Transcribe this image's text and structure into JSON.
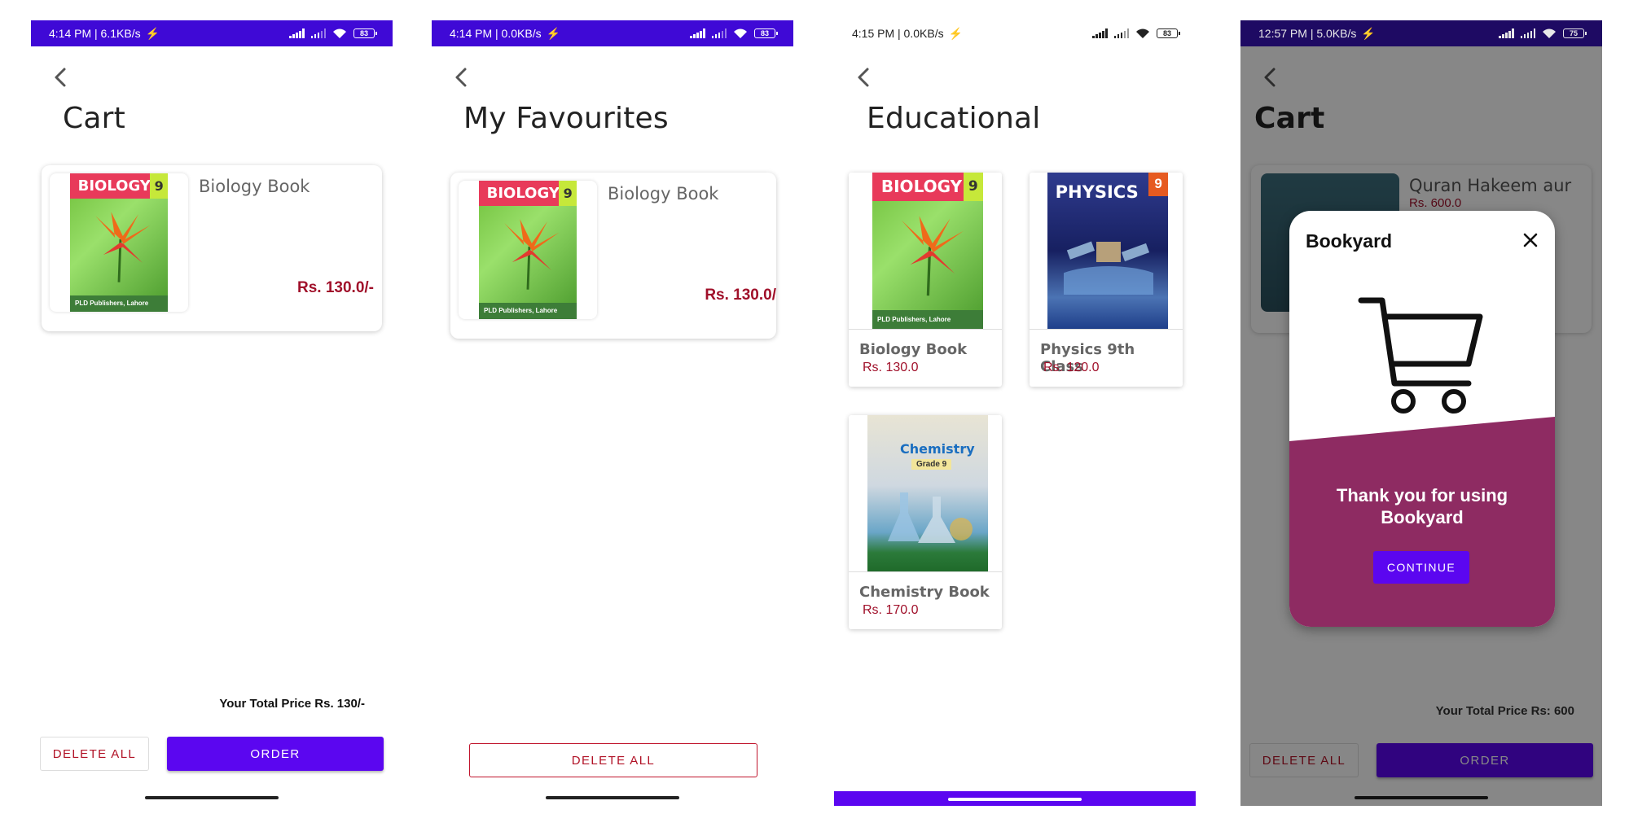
{
  "screens": {
    "cart": {
      "status": {
        "time": "4:14 PM | 6.1KB/s",
        "battery": "83"
      },
      "title": "Cart",
      "item": {
        "name": "Biology Book",
        "price": "Rs. 130.0/-",
        "cover_title": "BIOLOGY",
        "cover_grade": "9",
        "cover_publisher": "PLD Publishers, Lahore"
      },
      "total": "Your Total Price Rs. 130/-",
      "delete_all": "DELETE ALL",
      "order": "ORDER"
    },
    "favourites": {
      "status": {
        "time": "4:14 PM | 0.0KB/s",
        "battery": "83"
      },
      "title": "My Favourites",
      "item": {
        "name": "Biology Book",
        "price": "Rs. 130.0/",
        "cover_title": "BIOLOGY",
        "cover_grade": "9",
        "cover_publisher": "PLD Publishers, Lahore"
      },
      "delete_all": "DELETE ALL"
    },
    "educational": {
      "status": {
        "time": "4:15 PM | 0.0KB/s",
        "battery": "83"
      },
      "title": "Educational",
      "books": [
        {
          "name": "Biology Book",
          "price": "Rs. 130.0",
          "cover_title": "BIOLOGY",
          "cover_grade": "9",
          "cover_publisher": "PLD Publishers, Lahore"
        },
        {
          "name": "Physics 9th Class",
          "price": "Rs. 120.0",
          "cover_title": "PHYSICS",
          "cover_grade": "9"
        },
        {
          "name": "Chemistry Book",
          "price": "Rs. 170.0",
          "cover_title": "Chemistry",
          "cover_grade": "Grade 9"
        }
      ]
    },
    "cart_dialog": {
      "status": {
        "time": "12:57 PM | 5.0KB/s",
        "battery": "75"
      },
      "title": "Cart",
      "item": {
        "name": "Quran Hakeem aur",
        "price": "Rs. 600.0"
      },
      "total": "Your Total Price Rs: 600",
      "delete_all": "DELETE ALL",
      "order": "ORDER",
      "dialog": {
        "title": "Bookyard",
        "message_line1": "Thank you for using",
        "message_line2": "Bookyard",
        "continue": "CONTINUE"
      }
    }
  },
  "colors": {
    "accent": "#5b06f0",
    "status_bar": "#3f09d6",
    "price": "#a0102a",
    "dialog_bottom": "#8e2b62"
  },
  "icons": [
    "back-arrow-icon",
    "signal-icon",
    "wifi-icon",
    "battery-icon",
    "close-icon",
    "cart-icon"
  ]
}
